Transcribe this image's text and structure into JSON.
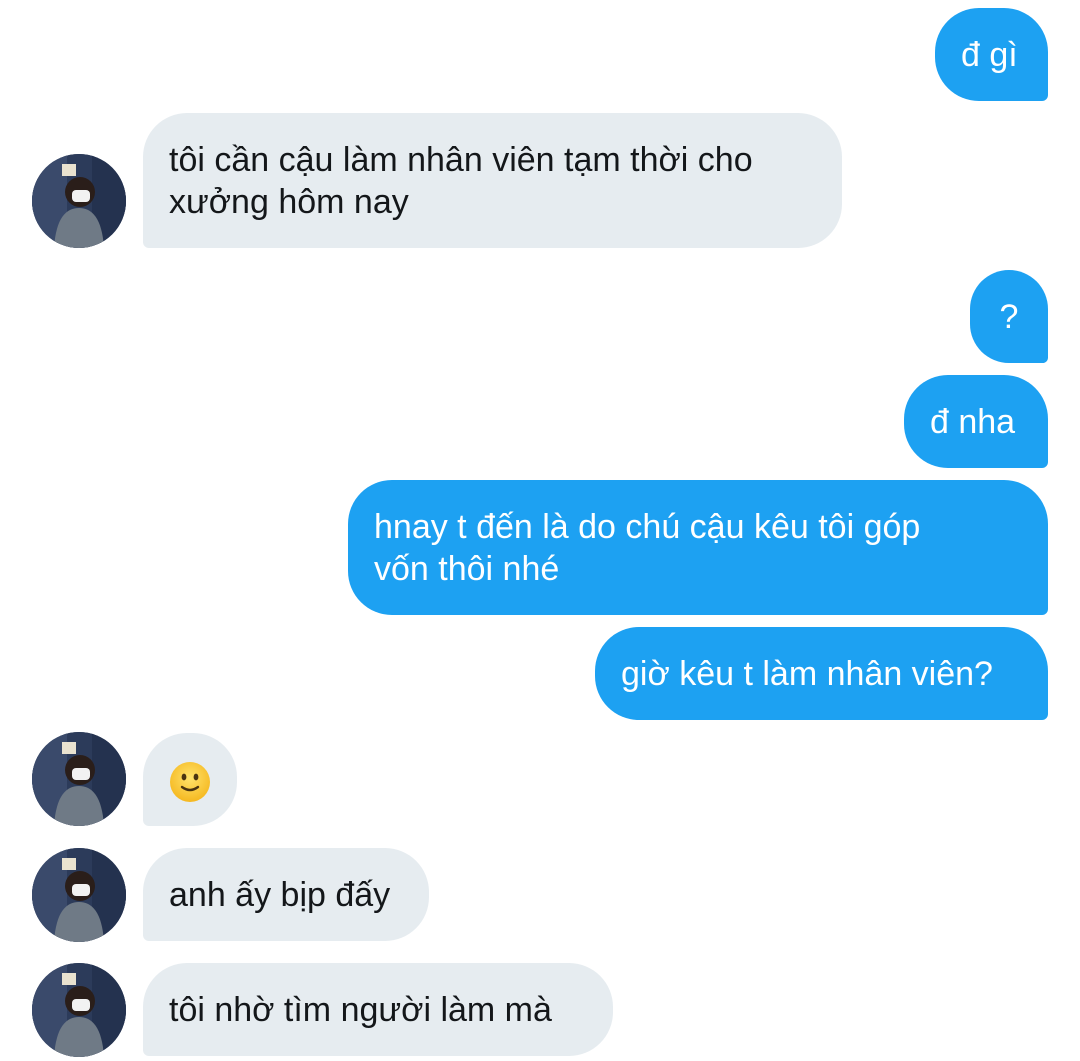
{
  "colors": {
    "outgoing_bubble": "#1da1f2",
    "incoming_bubble": "#e6ecf0",
    "outgoing_text": "#ffffff",
    "incoming_text": "#14171a"
  },
  "messages": [
    {
      "direction": "outgoing",
      "text": "đ gì"
    },
    {
      "direction": "incoming",
      "lines": [
        "tôi cần cậu làm nhân viên tạm thời cho",
        "xưởng hôm nay"
      ]
    },
    {
      "direction": "outgoing",
      "text": "?"
    },
    {
      "direction": "outgoing",
      "text": "đ nha"
    },
    {
      "direction": "outgoing",
      "lines": [
        "hnay t đến là do chú cậu kêu tôi góp",
        "vốn thôi nhé"
      ]
    },
    {
      "direction": "outgoing",
      "text": "giờ kêu t làm nhân viên?"
    },
    {
      "direction": "incoming",
      "emoji": "slightly-smiling-face-icon"
    },
    {
      "direction": "incoming",
      "text": "anh ấy bịp đấy"
    },
    {
      "direction": "incoming",
      "text": "tôi nhờ tìm người làm mà"
    }
  ]
}
